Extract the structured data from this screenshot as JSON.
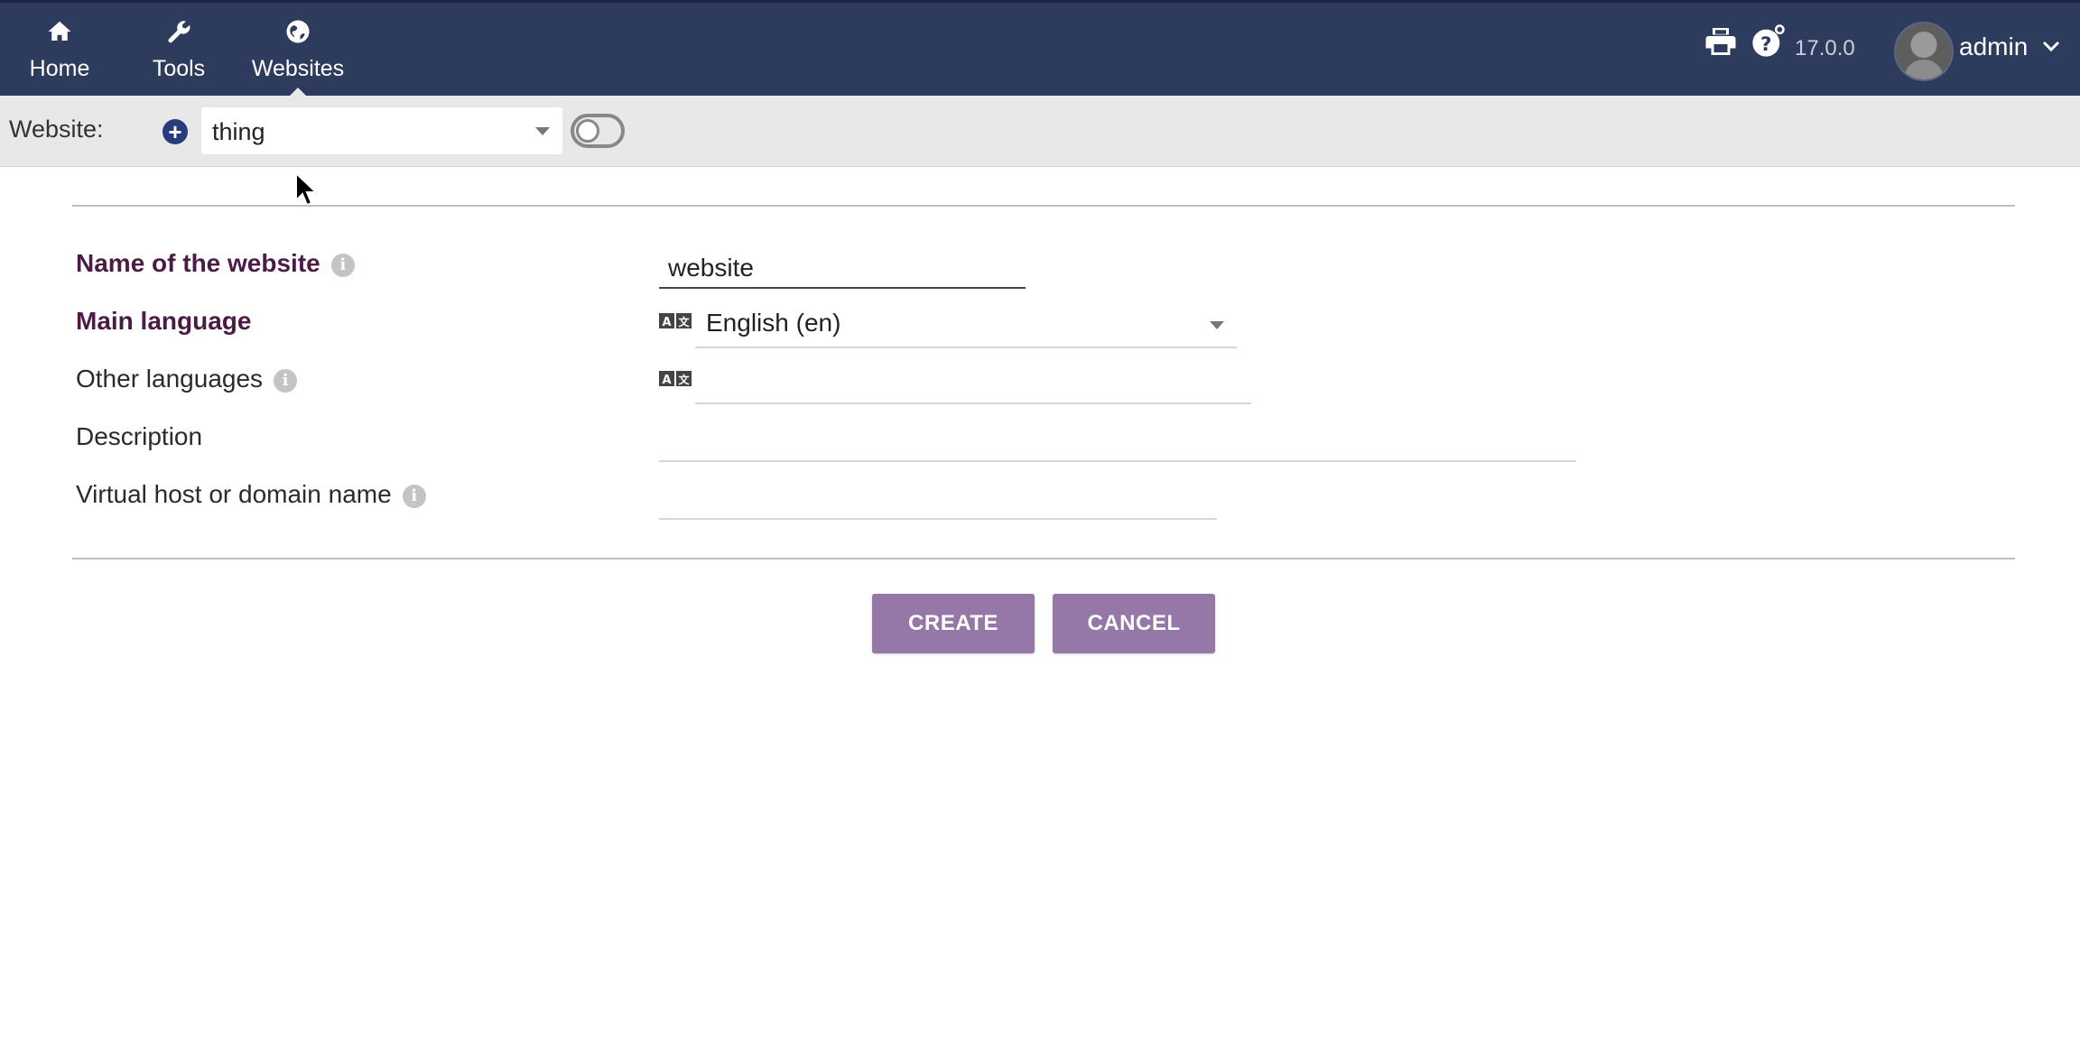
{
  "topnav": {
    "items": [
      {
        "label": "Home",
        "icon": "home-icon"
      },
      {
        "label": "Tools",
        "icon": "wrench-icon"
      },
      {
        "label": "Websites",
        "icon": "globe-icon"
      }
    ],
    "active": "Websites",
    "version": "17.0.0",
    "username": "admin",
    "background_color": "#2d3b5c"
  },
  "sitebar": {
    "label": "Website:",
    "selected_site": "thing"
  },
  "form": {
    "fields": {
      "name": {
        "label": "Name of the website",
        "value": "website",
        "required": true,
        "has_info": true
      },
      "main_language": {
        "label": "Main language",
        "value": "English (en)",
        "required": true
      },
      "other_languages": {
        "label": "Other languages",
        "value": "",
        "has_info": true
      },
      "description": {
        "label": "Description",
        "value": ""
      },
      "virtual_host": {
        "label": "Virtual host or domain name",
        "value": "",
        "has_info": true
      }
    },
    "buttons": {
      "create": "CREATE",
      "cancel": "CANCEL"
    },
    "button_color": "#9577a8",
    "required_label_color": "#4a1c45"
  }
}
